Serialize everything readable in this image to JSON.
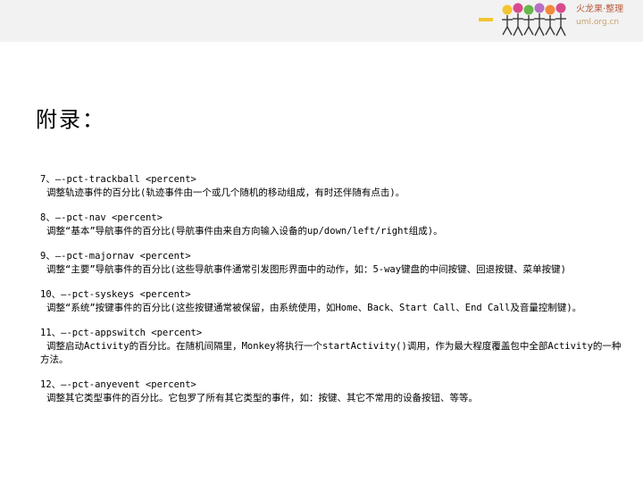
{
  "header": {
    "brand_name": "火龙果·整理",
    "brand_url": "uml.org.cn"
  },
  "title": "附录：",
  "items": [
    {
      "cmd": "7、–-pct-trackball <percent>",
      "desc": "调整轨迹事件的百分比(轨迹事件由一个或几个随机的移动组成，有时还伴随有点击)。"
    },
    {
      "cmd": "8、–-pct-nav <percent>",
      "desc": "调整“基本”导航事件的百分比(导航事件由来自方向输入设备的up/down/left/right组成)。"
    },
    {
      "cmd": "9、–-pct-majornav <percent>",
      "desc": "调整“主要”导航事件的百分比(这些导航事件通常引发图形界面中的动作，如：5-way键盘的中间按键、回退按键、菜单按键)"
    },
    {
      "cmd": "10、–-pct-syskeys <percent>",
      "desc": "调整“系统”按键事件的百分比(这些按键通常被保留，由系统使用，如Home、Back、Start Call、End Call及音量控制键)。"
    },
    {
      "cmd": "11、–-pct-appswitch <percent>",
      "desc": "调整启动Activity的百分比。在随机间隔里，Monkey将执行一个startActivity()调用，作为最大程度覆盖包中全部Activity的一种方法。"
    },
    {
      "cmd": "12、–-pct-anyevent <percent>",
      "desc": "调整其它类型事件的百分比。它包罗了所有其它类型的事件，如：按键、其它不常用的设备按钮、等等。"
    }
  ],
  "colors": {
    "topbar": "#f2f2f2",
    "brand": "#b85a3a"
  },
  "icons": [
    "colorful-people-logo-icon"
  ]
}
